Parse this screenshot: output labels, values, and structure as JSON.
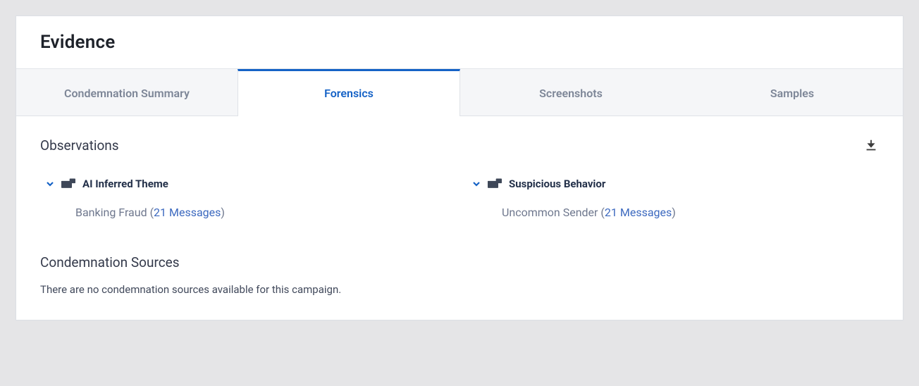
{
  "header": {
    "title": "Evidence"
  },
  "tabs": [
    {
      "label": "Condemnation Summary",
      "active": false
    },
    {
      "label": "Forensics",
      "active": true
    },
    {
      "label": "Screenshots",
      "active": false
    },
    {
      "label": "Samples",
      "active": false
    }
  ],
  "observations": {
    "title": "Observations",
    "categories": [
      {
        "name": "AI Inferred Theme",
        "items": [
          {
            "label": "Banking Fraud",
            "count_text": "21 Messages"
          }
        ]
      },
      {
        "name": "Suspicious Behavior",
        "items": [
          {
            "label": "Uncommon Sender",
            "count_text": "21 Messages"
          }
        ]
      }
    ]
  },
  "condemnation_sources": {
    "title": "Condemnation Sources",
    "empty_text": "There are no condemnation sources available for this campaign."
  }
}
